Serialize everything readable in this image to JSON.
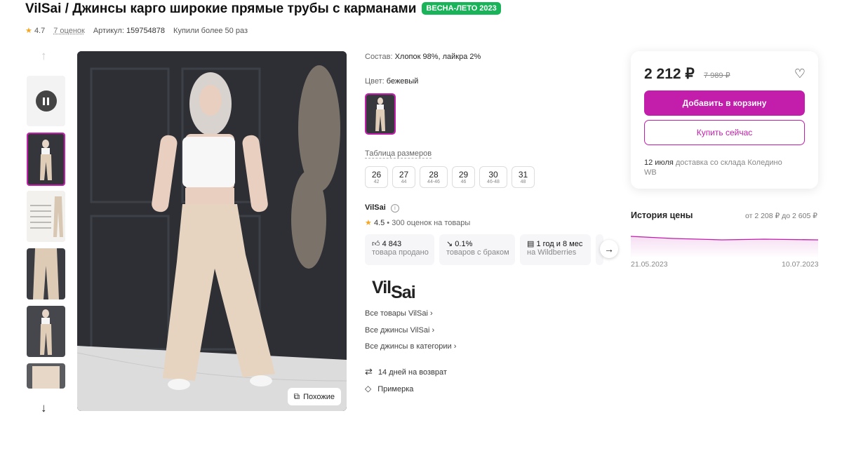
{
  "product": {
    "brand": "VilSai",
    "title": "VilSai / Джинсы карго широкие прямые трубы с карманами",
    "season_badge": "ВЕСНА-ЛЕТО 2023",
    "rating": "4.7",
    "reviews": "7 оценок",
    "article_label": "Артикул:",
    "article": "159754878",
    "bought": "Купили более 50 раз"
  },
  "gallery": {
    "similar_label": "Похожие",
    "pause_icon": "pause-icon",
    "up_icon": "arrow-up-icon",
    "down_icon": "arrow-down-icon"
  },
  "details": {
    "composition_label": "Состав:",
    "composition": "Хлопок 98%, лайкра 2%",
    "color_label": "Цвет:",
    "color": "бежевый",
    "size_table_label": "Таблица размеров",
    "sizes": [
      {
        "size": "26",
        "ru": "42"
      },
      {
        "size": "27",
        "ru": "44"
      },
      {
        "size": "28",
        "ru": "44-46"
      },
      {
        "size": "29",
        "ru": "46"
      },
      {
        "size": "30",
        "ru": "46-48"
      },
      {
        "size": "31",
        "ru": "48"
      }
    ]
  },
  "seller": {
    "name": "VilSai",
    "rating": "4.5",
    "rating_text": "• 300 оценок на товары",
    "stats": [
      {
        "top": "4 843",
        "sub": "товара продано",
        "icon": "thumbs-up-icon"
      },
      {
        "top": "0.1%",
        "sub": "товаров с браком",
        "icon": "trend-down-icon"
      },
      {
        "top": "1 год и 8 мес",
        "sub": "на Wildberries",
        "icon": "calendar-icon"
      }
    ],
    "logo_text_1": "Vil",
    "logo_text_2": "Sai",
    "links": [
      "Все товары VilSai",
      "Все джинсы VilSai",
      "Все джинсы в категории"
    ],
    "return_text": "14 дней на возврат",
    "fitting_text": "Примерка"
  },
  "price": {
    "current": "2 212 ₽",
    "old": "7 989 ₽",
    "add_to_cart": "Добавить в корзину",
    "buy_now": "Купить сейчас",
    "delivery_date": "12 июля",
    "delivery_text": "доставка со склада Коледино WB"
  },
  "price_history": {
    "title": "История цены",
    "range": "от 2 208 ₽ до 2 605 ₽",
    "start_date": "21.05.2023",
    "end_date": "10.07.2023"
  },
  "colors": {
    "accent": "#c21dab",
    "season": "#19b45a",
    "star": "#f5a623"
  }
}
